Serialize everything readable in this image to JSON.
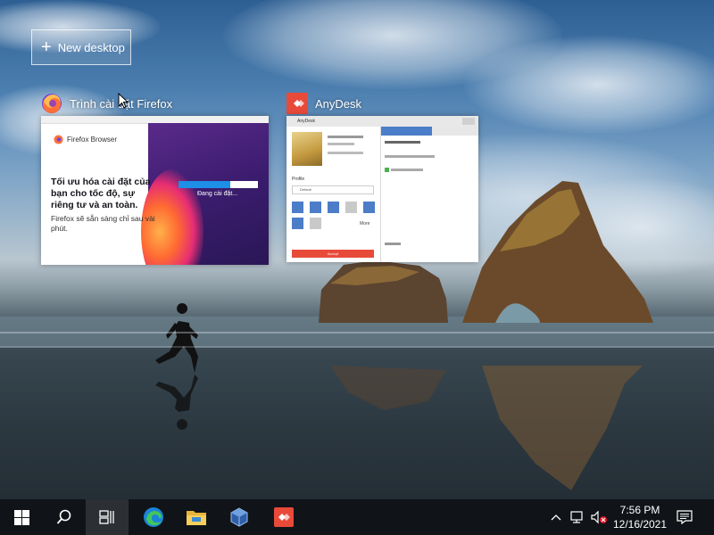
{
  "virtual_desktops": {
    "new_desktop_label": "New desktop"
  },
  "windows": [
    {
      "title": "Trình cài đặt Firefox",
      "app": "firefox",
      "thumbnail": {
        "brand": "Firefox Browser",
        "heading": "Tối ưu hóa cài đặt của bạn cho tốc độ, sự riêng tư và an toàn.",
        "subtext": "Firefox sẽ sẵn sàng chỉ sau vài phút.",
        "progress_label": "Đang cài đặt...",
        "progress_fraction": 0.65
      }
    },
    {
      "title": "AnyDesk",
      "app": "anydesk",
      "thumbnail": {
        "window_title": "AnyDesk",
        "profile_label": "Profile",
        "profile_value": "Default",
        "more_label": "More",
        "apply_label": "Accept"
      }
    }
  ],
  "taskbar": {
    "start_icon": "windows-logo-icon",
    "search_icon": "search-icon",
    "taskview_icon": "task-view-icon",
    "pinned": [
      "edge-icon",
      "file-explorer-icon",
      "virtualbox-icon",
      "anydesk-icon"
    ],
    "tray_icons": [
      "chevron-up-icon",
      "network-icon",
      "volume-muted-icon",
      "notification-icon"
    ]
  },
  "clock": {
    "time": "7:56 PM",
    "date": "12/16/2021"
  },
  "colors": {
    "taskbar_bg": "#101418",
    "anydesk_red": "#e84a3a",
    "anydesk_blue": "#4c7dc8",
    "firefox_purple": "#3b1c6e",
    "progress_blue": "#1d8fe6"
  }
}
